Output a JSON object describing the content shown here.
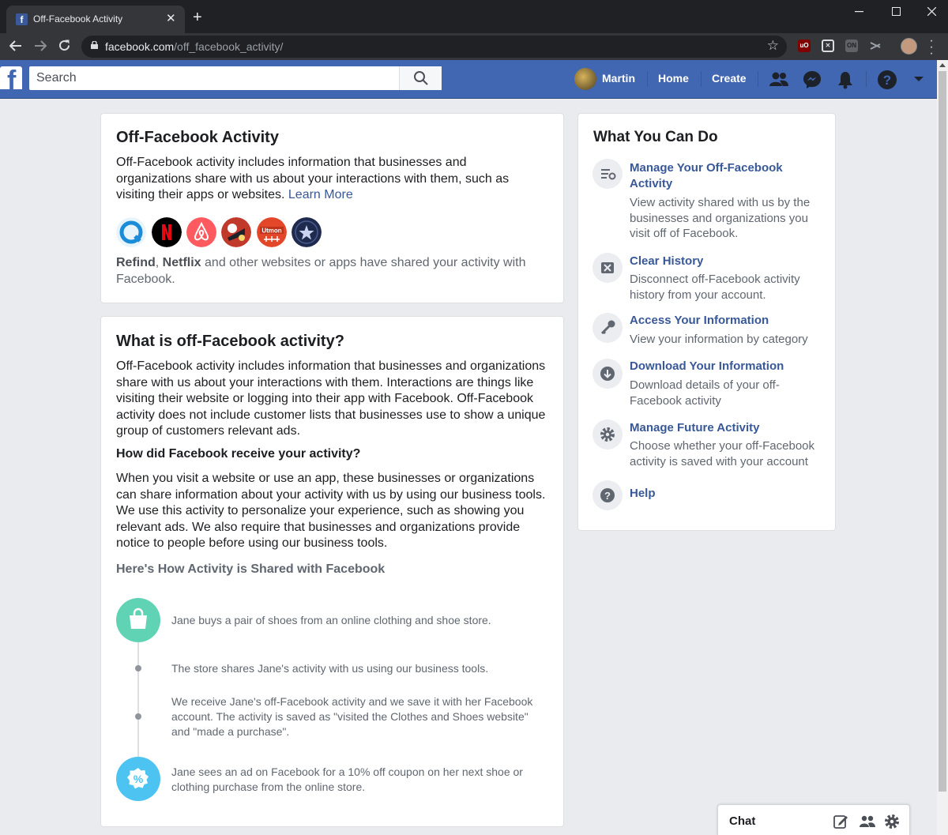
{
  "browser": {
    "tab_title": "Off-Facebook Activity",
    "url_host": "facebook.com",
    "url_path": "/off_facebook_activity/",
    "new_tab_label": "+",
    "close_tab_label": "✕"
  },
  "fb_header": {
    "search_placeholder": "Search",
    "user_name": "Martin",
    "home_label": "Home",
    "create_label": "Create"
  },
  "summary_card": {
    "title": "Off-Facebook Activity",
    "description": "Off-Facebook activity includes information that businesses and organizations share with us about your interactions with them, such as visiting their apps or websites.",
    "learn_more": "Learn More",
    "apps": [
      {
        "name": "refind-icon",
        "color": "#1a8cd8"
      },
      {
        "name": "netflix-icon",
        "color": "#000000"
      },
      {
        "name": "airbnb-icon",
        "color": "#ff5a5f"
      },
      {
        "name": "game-app-icon",
        "color": "#c0392b"
      },
      {
        "name": "utmon-icon",
        "color": "#e2472a"
      },
      {
        "name": "star-app-icon",
        "color": "#1f2a4f"
      }
    ],
    "shared_app_1": "Refind",
    "shared_sep": ", ",
    "shared_app_2": "Netflix",
    "shared_rest": " and other websites or apps have shared your activity with Facebook."
  },
  "explain_card": {
    "title": "What is off-Facebook activity?",
    "paragraph_1": "Off-Facebook activity includes information that businesses and organizations share with us about your interactions with them. Interactions are things like visiting their website or logging into their app with Facebook. Off-Facebook activity does not include customer lists that businesses use to show a unique group of customers relevant ads.",
    "subtitle": "How did Facebook receive your activity?",
    "paragraph_2": "When you visit a website or use an app, these businesses or organizations can share information about your activity with us by using our business tools. We use this activity to personalize your experience, such as showing you relevant ads. We also require that businesses and organizations provide notice to people before using our business tools.",
    "flow_heading": "Here's How Activity is Shared with Facebook",
    "flow_steps": [
      "Jane buys a pair of shoes from an online clothing and shoe store.",
      "The store shares Jane's activity with us using our business tools.",
      "We receive Jane's off-Facebook activity and we save it with her Facebook account. The activity is saved as \"visited the Clothes and Shoes website\" and \"made a purchase\".",
      "Jane sees an ad on Facebook for a 10% off coupon on her next shoe or clothing purchase from the online store."
    ],
    "colors": {
      "shop": "#5fd3b4",
      "coupon": "#4cc3f0"
    }
  },
  "actions_card": {
    "title": "What You Can Do",
    "items": [
      {
        "title": "Manage Your Off-Facebook Activity",
        "desc": "View activity shared with us by the businesses and organizations you visit off of Facebook.",
        "icon": "manage-list-icon"
      },
      {
        "title": "Clear History",
        "desc": "Disconnect off-Facebook activity history from your account.",
        "icon": "clear-x-icon"
      },
      {
        "title": "Access Your Information",
        "desc": "View your information by category",
        "icon": "key-icon"
      },
      {
        "title": "Download Your Information",
        "desc": "Download details of your off-Facebook activity",
        "icon": "download-icon"
      },
      {
        "title": "Manage Future Activity",
        "desc": "Choose whether your off-Facebook activity is saved with your account",
        "icon": "gear-icon"
      },
      {
        "title": "Help",
        "desc": "",
        "icon": "help-icon"
      }
    ]
  },
  "chat": {
    "label": "Chat"
  },
  "theme": {
    "fb_blue": "#4267b2",
    "link": "#385898"
  }
}
